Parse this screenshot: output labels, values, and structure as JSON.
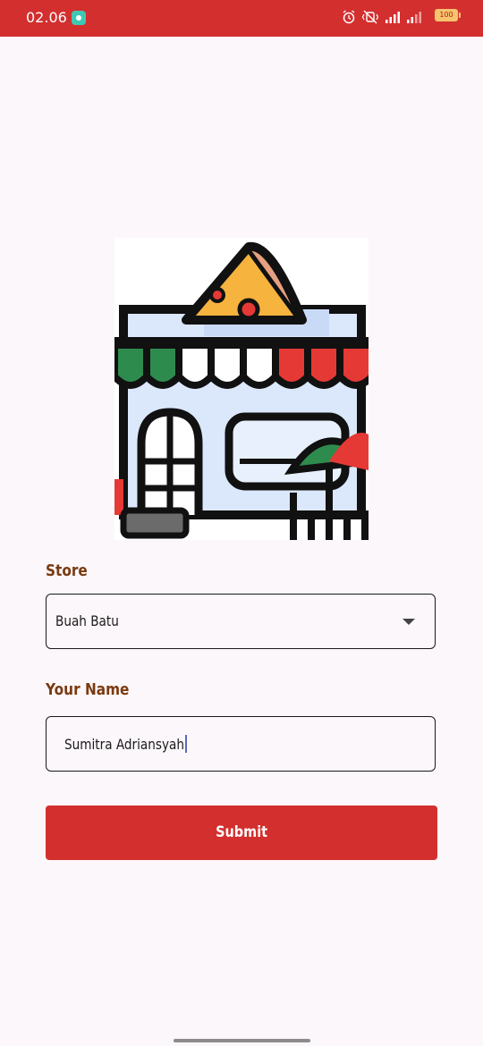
{
  "status_bar": {
    "time": "02.06",
    "battery_level": "100",
    "background_color": "#d32f2f",
    "icons": [
      "chat-app-icon",
      "alarm-icon",
      "vibrate-icon",
      "signal-icon",
      "signal-weak-icon",
      "battery-icon"
    ]
  },
  "form": {
    "store_label": "Store",
    "store_selected": "Buah Batu",
    "name_label": "Your Name",
    "name_value": "Sumitra Adriansyah",
    "submit_label": "Submit"
  },
  "colors": {
    "accent": "#d32f2f",
    "label": "#7a3b12",
    "background": "#fcf7fa"
  }
}
